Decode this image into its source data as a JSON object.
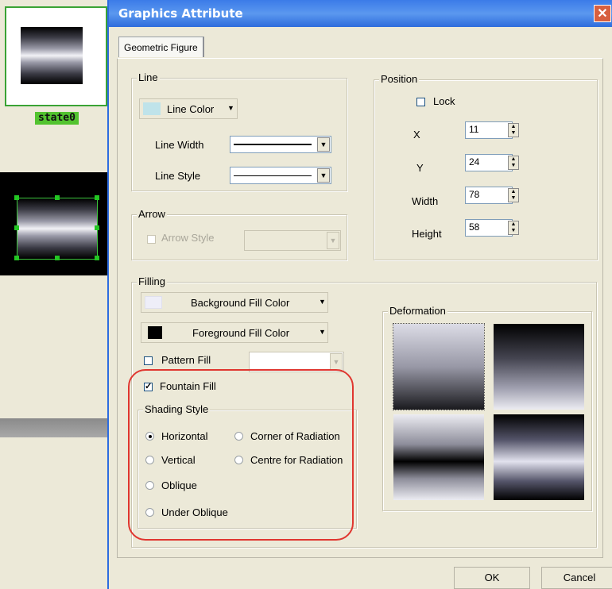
{
  "left_panel": {
    "state_label": "state0"
  },
  "dialog": {
    "title": "Graphics Attribute",
    "close_glyph": "✕",
    "tab_label": "Geometric Figure",
    "line_group": {
      "legend": "Line",
      "line_color_label": "Line Color",
      "line_width_label": "Line Width",
      "line_style_label": "Line Style"
    },
    "arrow_group": {
      "legend": "Arrow",
      "arrow_style_label": "Arrow Style"
    },
    "position_group": {
      "legend": "Position",
      "lock_label": "Lock",
      "x_label": "X",
      "x_value": "11",
      "y_label": "Y",
      "y_value": "24",
      "width_label": "Width",
      "width_value": "78",
      "height_label": "Height",
      "height_value": "58"
    },
    "filling_group": {
      "legend": "Filling",
      "background_fill_label": "Background Fill Color",
      "foreground_fill_label": "Foreground Fill Color",
      "pattern_fill_label": "Pattern Fill",
      "fountain_fill_label": "Fountain Fill",
      "fountain_fill_checked": true,
      "shading_style": {
        "legend": "Shading Style",
        "options": [
          "Horizontal",
          "Vertical",
          "Oblique",
          "Under Oblique",
          "Corner of Radiation",
          "Centre for Radiation"
        ],
        "selected": "Horizontal"
      }
    },
    "deformation_group": {
      "legend": "Deformation"
    },
    "ok_label": "OK",
    "cancel_label": "Cancel",
    "colors": {
      "line_color": "#bfe3ea",
      "background_fill": "#eeeef8",
      "foreground_fill": "#000000",
      "highlight": "#e0362f"
    }
  }
}
